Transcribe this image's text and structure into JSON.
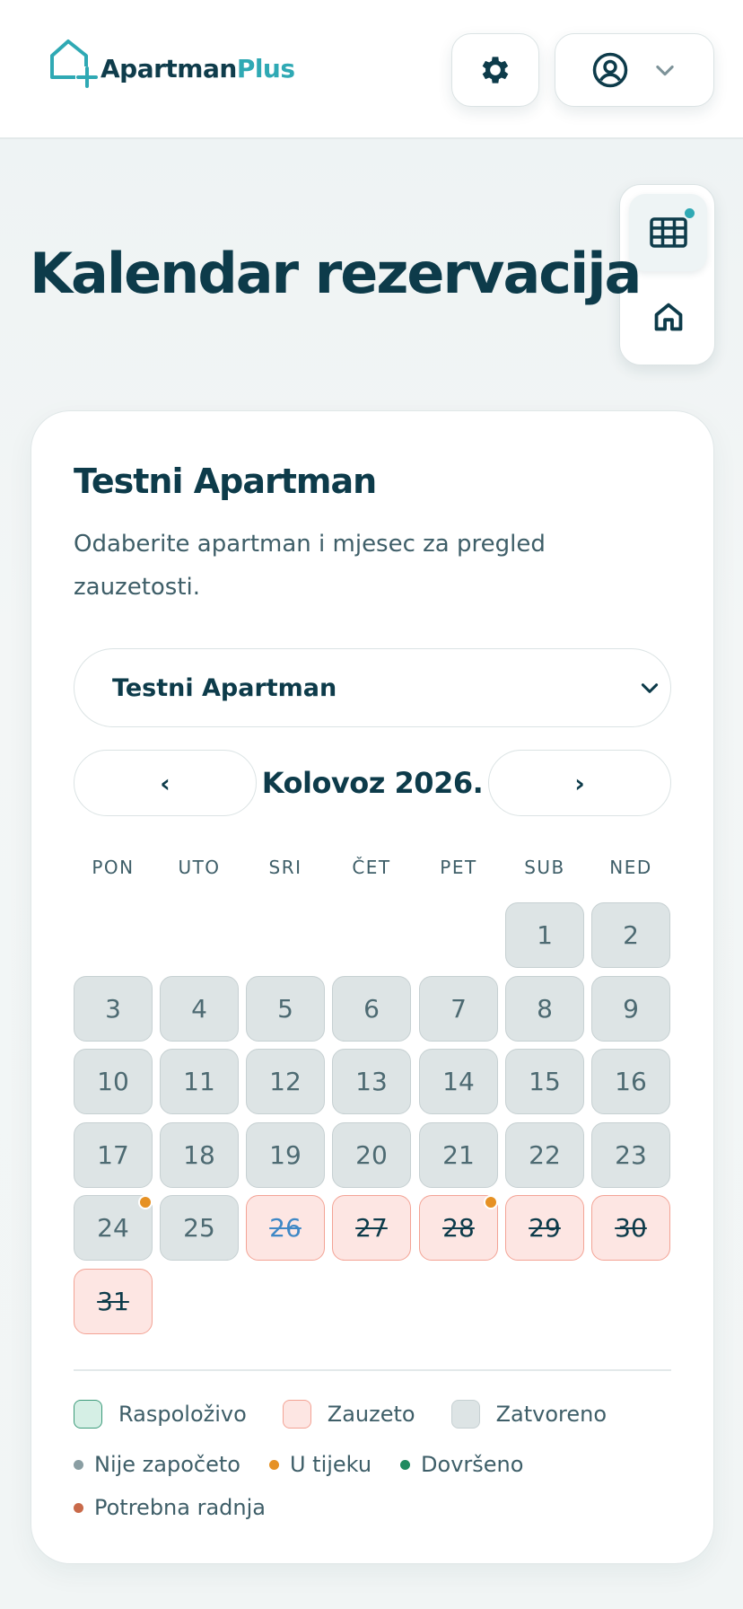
{
  "header": {
    "brand_primary": "Apartman",
    "brand_accent": "Plus",
    "settings_icon": "gear-icon",
    "user_icon": "user-circle-icon",
    "dropdown_icon": "chevron-down-icon"
  },
  "side_nav": {
    "items": [
      {
        "icon": "calendar-grid-icon",
        "active": true
      },
      {
        "icon": "home-icon",
        "active": false
      }
    ]
  },
  "page": {
    "title": "Kalendar rezervacija"
  },
  "card": {
    "title": "Testni Apartman",
    "description": "Odaberite apartman i mjesec za pregled zauzetosti.",
    "select": {
      "value": "Testni Apartman"
    },
    "month_nav": {
      "prev": "‹",
      "label": "Kolovoz 2026.",
      "next": "›"
    },
    "weekdays": [
      "PON",
      "UTO",
      "SRI",
      "ČET",
      "PET",
      "SUB",
      "NED"
    ],
    "days": [
      {
        "n": "1",
        "status": "closed"
      },
      {
        "n": "2",
        "status": "closed"
      },
      {
        "n": "3",
        "status": "closed"
      },
      {
        "n": "4",
        "status": "closed"
      },
      {
        "n": "5",
        "status": "closed"
      },
      {
        "n": "6",
        "status": "closed"
      },
      {
        "n": "7",
        "status": "closed"
      },
      {
        "n": "8",
        "status": "closed"
      },
      {
        "n": "9",
        "status": "closed"
      },
      {
        "n": "10",
        "status": "closed"
      },
      {
        "n": "11",
        "status": "closed"
      },
      {
        "n": "12",
        "status": "closed"
      },
      {
        "n": "13",
        "status": "closed"
      },
      {
        "n": "14",
        "status": "closed"
      },
      {
        "n": "15",
        "status": "closed"
      },
      {
        "n": "16",
        "status": "closed"
      },
      {
        "n": "17",
        "status": "closed"
      },
      {
        "n": "18",
        "status": "closed"
      },
      {
        "n": "19",
        "status": "closed"
      },
      {
        "n": "20",
        "status": "closed"
      },
      {
        "n": "21",
        "status": "closed"
      },
      {
        "n": "22",
        "status": "closed"
      },
      {
        "n": "23",
        "status": "closed"
      },
      {
        "n": "24",
        "status": "closed",
        "marker": "in-progress"
      },
      {
        "n": "25",
        "status": "closed"
      },
      {
        "n": "26",
        "status": "booked",
        "highlight": true
      },
      {
        "n": "27",
        "status": "booked"
      },
      {
        "n": "28",
        "status": "booked",
        "marker": "in-progress"
      },
      {
        "n": "29",
        "status": "booked"
      },
      {
        "n": "30",
        "status": "booked"
      },
      {
        "n": "31",
        "status": "booked"
      }
    ],
    "legend": {
      "available": "Raspoloživo",
      "booked": "Zauzeto",
      "closed": "Zatvoreno"
    },
    "statuses": [
      {
        "label": "Nije započeto",
        "color": "#8a9ea3"
      },
      {
        "label": "U tijeku",
        "color": "#e69124"
      },
      {
        "label": "Dovršeno",
        "color": "#1f8a5f"
      },
      {
        "label": "Potrebna radnja",
        "color": "#c96a4a"
      }
    ]
  },
  "colors": {
    "brand_dark": "#0d3b4a",
    "brand_accent": "#2fa9b4",
    "booked_bg": "#fde6e3",
    "closed_bg": "#dde4e5",
    "available_bg": "#d5efe5"
  }
}
